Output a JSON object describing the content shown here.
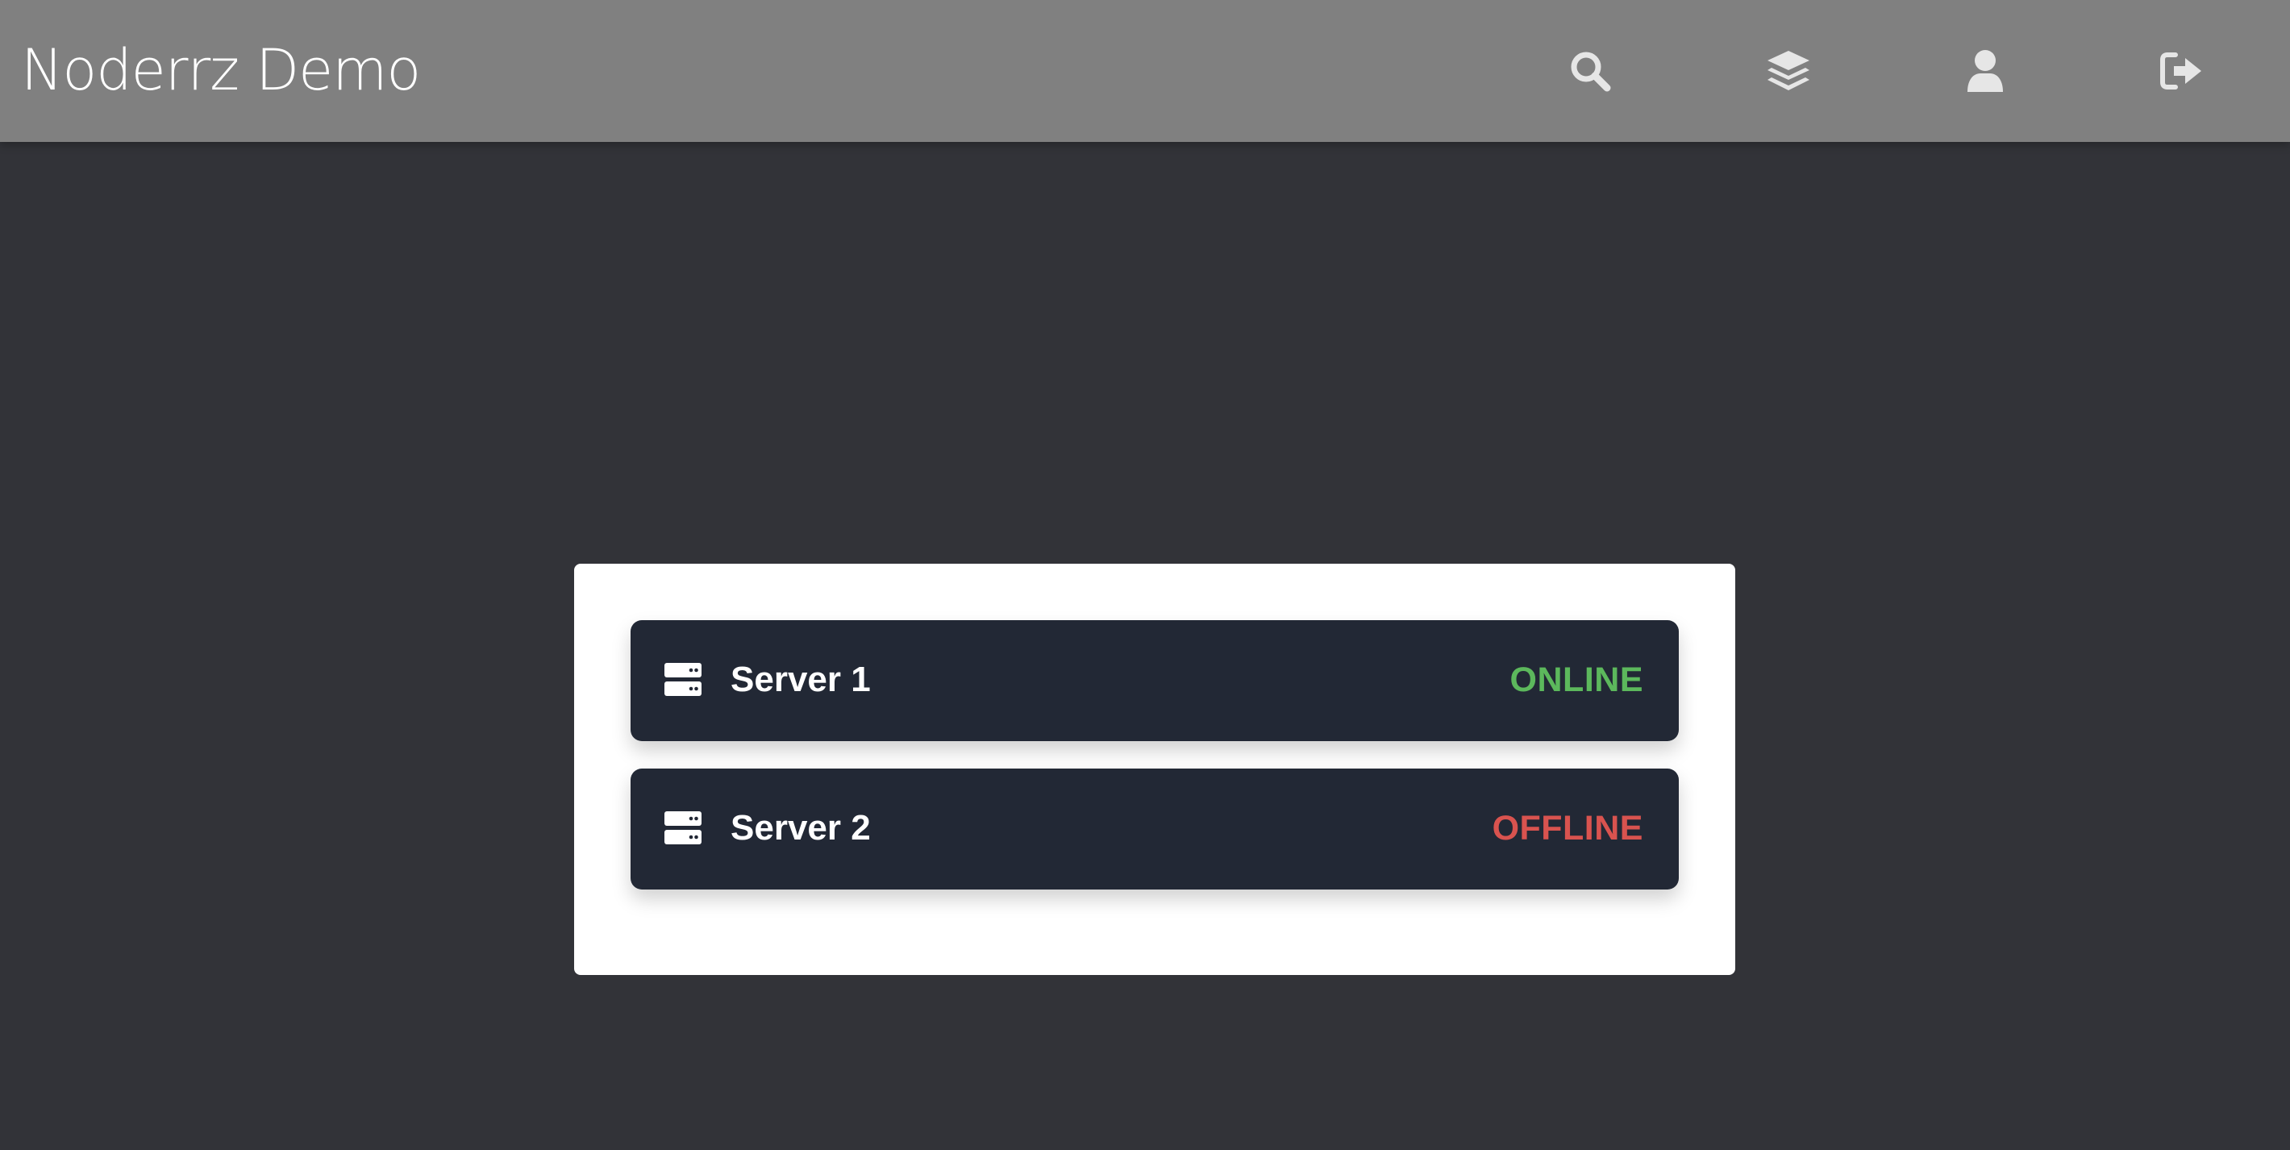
{
  "app": {
    "title": "Noderrz Demo"
  },
  "nav": {
    "items": [
      {
        "icon": "search-icon"
      },
      {
        "icon": "layers-icon"
      },
      {
        "icon": "user-icon"
      },
      {
        "icon": "logout-icon"
      }
    ]
  },
  "servers": [
    {
      "name": "Server 1",
      "status": "ONLINE",
      "status_color": "#5cb85c",
      "icon": "server-icon"
    },
    {
      "name": "Server 2",
      "status": "OFFLINE",
      "status_color": "#d9534f",
      "icon": "server-icon"
    }
  ],
  "colors": {
    "header_bg": "#808080",
    "page_bg": "#323338",
    "panel_bg": "#ffffff",
    "row_bg": "#222835"
  }
}
